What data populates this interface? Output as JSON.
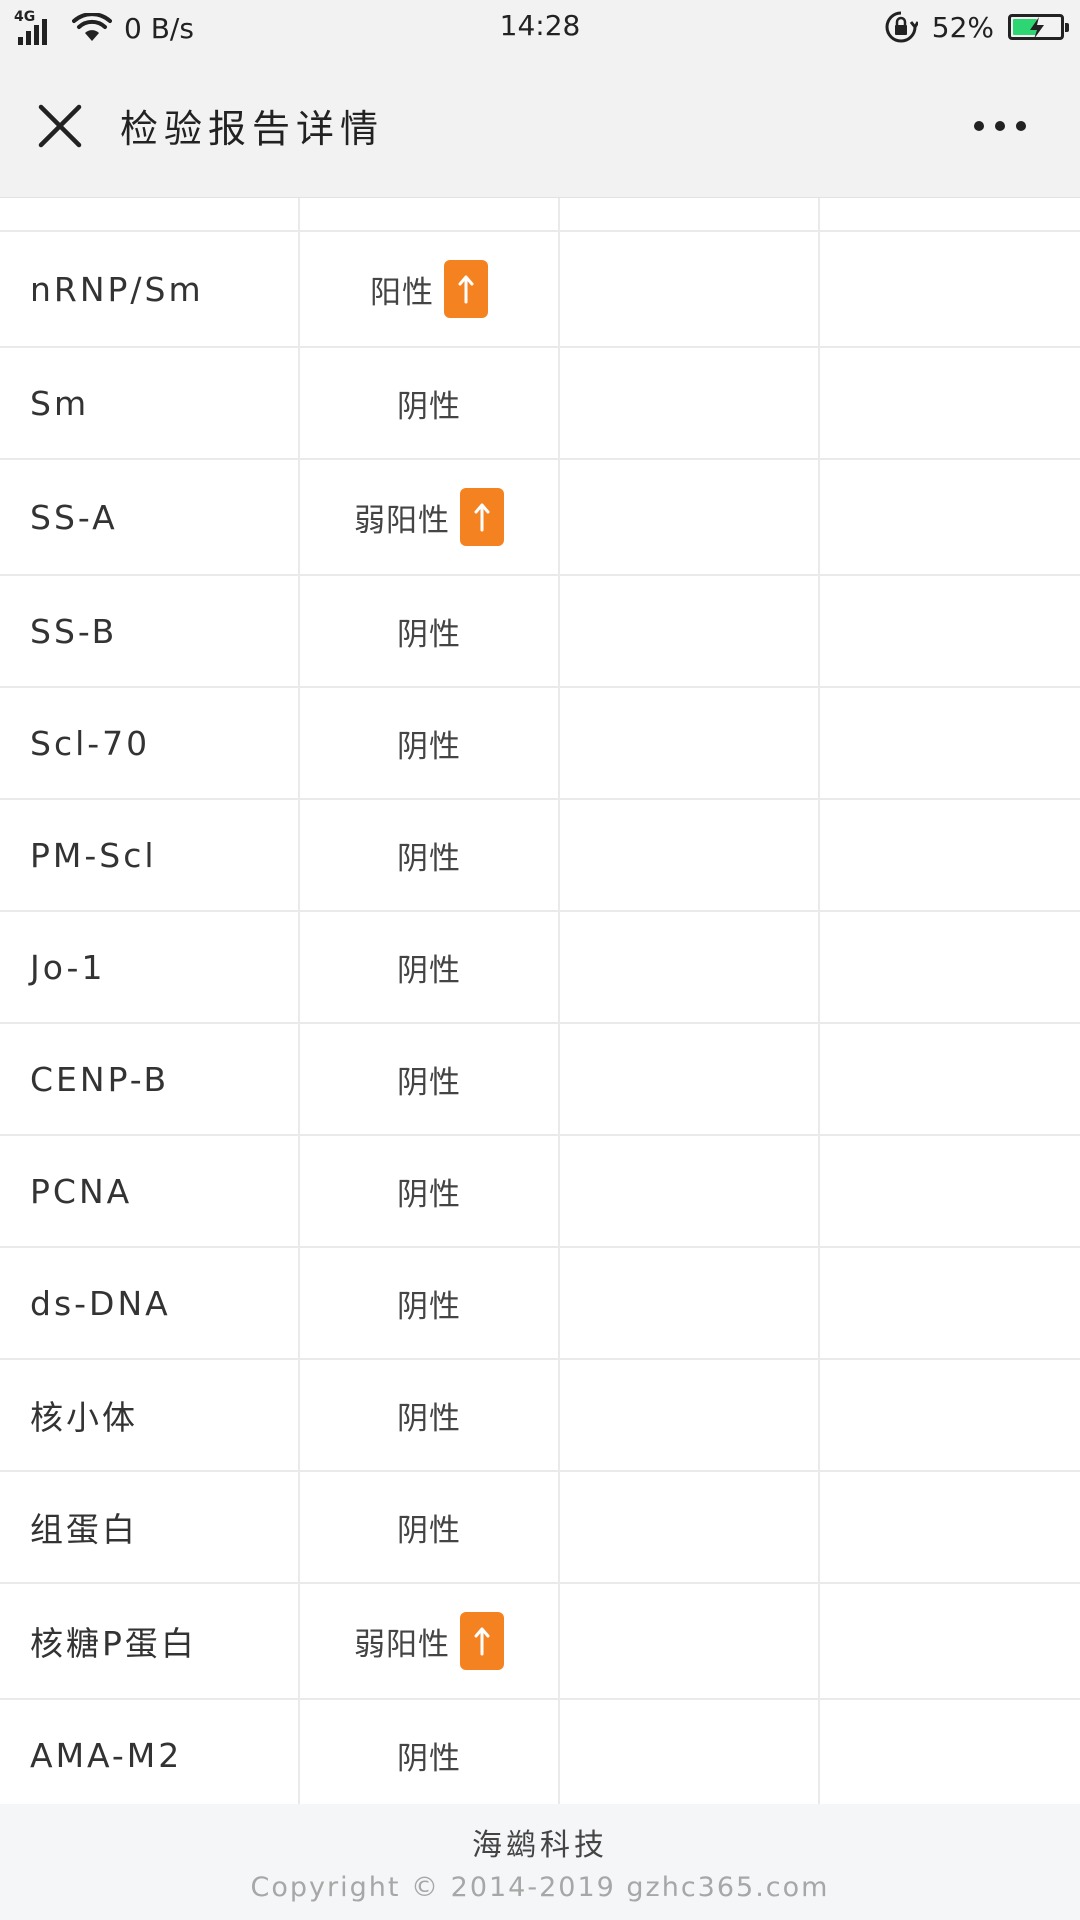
{
  "status_bar": {
    "network": "4G",
    "speed": "0 B/s",
    "time": "14:28",
    "battery": "52%",
    "battery_level": 0.52,
    "battery_color": "#2ed573"
  },
  "title_bar": {
    "title": "检验报告详情",
    "close_icon": "close-icon",
    "more_icon": "more-icon"
  },
  "table": {
    "rows": [
      {
        "name": "",
        "result": "",
        "flag": ""
      },
      {
        "name": "nRNP/Sm",
        "result": "阳性",
        "flag": "↑"
      },
      {
        "name": "Sm",
        "result": "阴性",
        "flag": ""
      },
      {
        "name": "SS-A",
        "result": "弱阳性",
        "flag": "↑"
      },
      {
        "name": "SS-B",
        "result": "阴性",
        "flag": ""
      },
      {
        "name": "Scl-70",
        "result": "阴性",
        "flag": ""
      },
      {
        "name": "PM-Scl",
        "result": "阴性",
        "flag": ""
      },
      {
        "name": "Jo-1",
        "result": "阴性",
        "flag": ""
      },
      {
        "name": "CENP-B",
        "result": "阴性",
        "flag": ""
      },
      {
        "name": "PCNA",
        "result": "阴性",
        "flag": ""
      },
      {
        "name": "ds-DNA",
        "result": "阴性",
        "flag": ""
      },
      {
        "name": "核小体",
        "result": "阴性",
        "flag": ""
      },
      {
        "name": "组蛋白",
        "result": "阴性",
        "flag": ""
      },
      {
        "name": "核糖P蛋白",
        "result": "弱阳性",
        "flag": "↑"
      },
      {
        "name": "AMA-M2",
        "result": "阴性",
        "flag": ""
      }
    ],
    "flag_color": "#f58220"
  },
  "footer": {
    "brand": "海鹚科技",
    "copyright": "Copyright © 2014-2019 gzhc365.com"
  }
}
